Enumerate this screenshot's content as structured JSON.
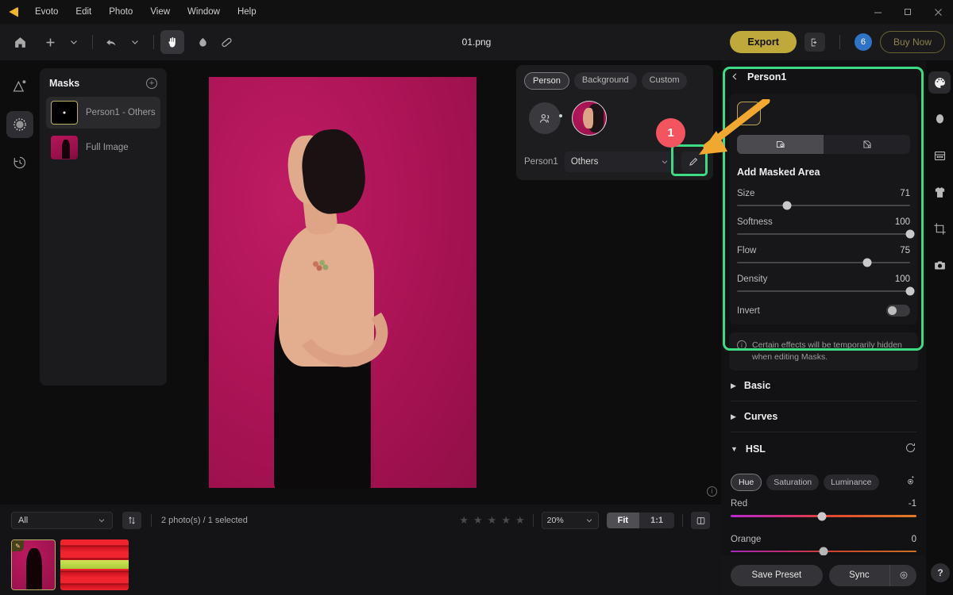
{
  "app": {
    "name": "Evoto",
    "logo_icon": "evoto-logo-icon",
    "menu": [
      "Evoto",
      "Edit",
      "Photo",
      "View",
      "Window",
      "Help"
    ],
    "window_controls": {
      "minimize": "—",
      "maximize": "❐",
      "close": "✕"
    }
  },
  "toolbar": {
    "home_icon": "home-icon",
    "add_icon": "plus-icon",
    "add_caret_icon": "chevron-down-icon",
    "undo_icon": "undo-arrow-icon",
    "undo_caret_icon": "chevron-down-icon",
    "hand_icon": "hand-tool-icon",
    "blur_icon": "blur-brush-icon",
    "heal_icon": "healing-patch-icon",
    "document_title": "01.png",
    "export_label": "Export",
    "share_icon": "export-share-icon",
    "credits_count": "6",
    "buy_now_label": "Buy Now"
  },
  "left_rail": {
    "items": [
      {
        "icon": "retouch-triangle-icon",
        "active": false
      },
      {
        "icon": "mask-dotted-circle-icon",
        "active": true
      },
      {
        "icon": "history-clock-icon",
        "active": false
      }
    ]
  },
  "masks_panel": {
    "title": "Masks",
    "add_icon": "plus-circle-icon",
    "items": [
      {
        "label": "Person1 - Others",
        "thumb": "black-mask-thumb",
        "selected": true
      },
      {
        "label": "Full Image",
        "thumb": "photo-thumb",
        "selected": false
      }
    ]
  },
  "canvas": {
    "info_icon": "info-icon",
    "photo_alt": "woman-in-black-dress-profile-on-crimson-background"
  },
  "mask_popover": {
    "tabs": [
      {
        "label": "Person",
        "active": true
      },
      {
        "label": "Background",
        "active": false
      },
      {
        "label": "Custom",
        "active": false
      }
    ],
    "people_icon": "people-group-icon",
    "person_thumb": "person1-face-thumb",
    "person_label": "Person1",
    "selected_part": "Others",
    "select_caret_icon": "chevron-down-icon",
    "edit_icon": "pencil-edit-icon",
    "callout_number": "1"
  },
  "right_panel": {
    "back_icon": "chevron-left-icon",
    "title": "Person1",
    "brush_tool_icon": "brush-icon",
    "modes": [
      {
        "icon": "add-mask-icon",
        "active": true
      },
      {
        "icon": "subtract-mask-icon",
        "active": false
      }
    ],
    "mode_title": "Add Masked Area",
    "sliders": [
      {
        "label": "Size",
        "value": "71",
        "percent": 29
      },
      {
        "label": "Softness",
        "value": "100",
        "percent": 100
      },
      {
        "label": "Flow",
        "value": "75",
        "percent": 75
      },
      {
        "label": "Density",
        "value": "100",
        "percent": 100
      }
    ],
    "invert": {
      "label": "Invert",
      "enabled": false
    },
    "notice": {
      "icon": "info-icon",
      "text": "Certain effects will be temporarily hidden when editing Masks."
    },
    "accordions": [
      {
        "label": "Basic",
        "expanded": false,
        "caret_icon": "caret-right-icon"
      },
      {
        "label": "Curves",
        "expanded": false,
        "caret_icon": "caret-right-icon"
      },
      {
        "label": "HSL",
        "expanded": true,
        "caret_icon": "caret-down-icon",
        "reset_icon": "reset-circle-arrow-icon"
      }
    ],
    "hsl": {
      "tabs": [
        {
          "label": "Hue",
          "active": true
        },
        {
          "label": "Saturation",
          "active": false
        },
        {
          "label": "Luminance",
          "active": false
        }
      ],
      "eyedropper_icon": "target-picker-icon",
      "channels": [
        {
          "label": "Red",
          "value": "-1",
          "percent": 49
        },
        {
          "label": "Orange",
          "value": "0",
          "percent": 50
        }
      ]
    },
    "footer": {
      "save_preset_label": "Save Preset",
      "sync_label": "Sync",
      "sync_options_icon": "sync-settings-icon"
    }
  },
  "right_rail": {
    "items": [
      {
        "icon": "color-palette-icon",
        "active": true
      },
      {
        "icon": "face-retouch-icon",
        "active": false
      },
      {
        "icon": "texture-grid-icon",
        "active": false
      },
      {
        "icon": "clothing-shirt-icon",
        "active": false
      },
      {
        "icon": "crop-icon",
        "active": false
      },
      {
        "icon": "camera-icon",
        "active": false
      }
    ],
    "help_label": "?"
  },
  "bottom_bar": {
    "filter_value": "All",
    "filter_caret_icon": "chevron-down-icon",
    "sort_icon": "sort-arrows-icon",
    "count_text": "2 photo(s) / 1 selected",
    "rating_stars": 5,
    "star_icon": "star-icon",
    "zoom_value": "20%",
    "zoom_caret_icon": "chevron-down-icon",
    "view_modes": [
      {
        "label": "Fit",
        "active": true
      },
      {
        "label": "1:1",
        "active": false
      }
    ],
    "compare_icon": "split-compare-icon",
    "filmstrip": [
      {
        "thumb": "portrait-thumb",
        "badge_icon": "edited-pencil-icon",
        "selected": true
      },
      {
        "thumb": "red-stripes-thumb",
        "badge_icon": null,
        "selected": false
      }
    ]
  },
  "annotations": {
    "arrow_color": "#F0A830",
    "highlight_color": "#3DDC84",
    "badge_color": "#F2555F"
  }
}
